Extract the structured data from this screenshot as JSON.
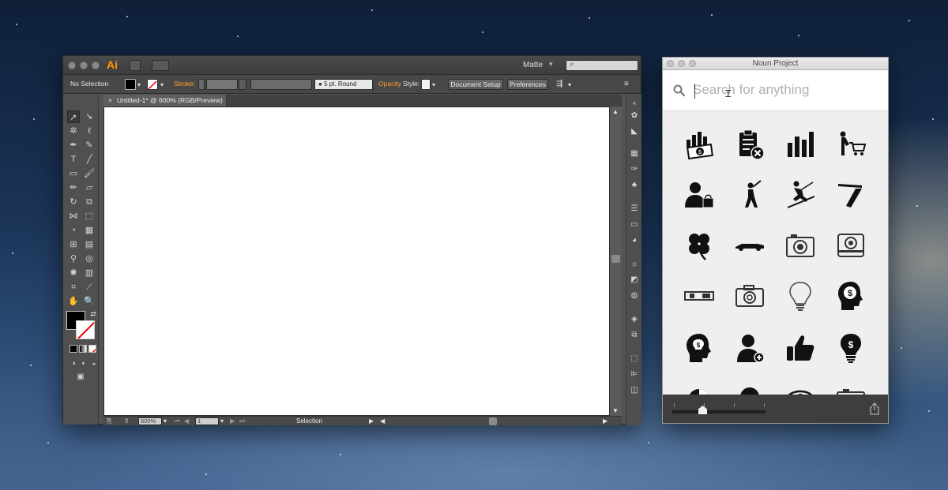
{
  "illustrator": {
    "logo": "Ai",
    "workspace": "Matte",
    "control_bar": {
      "selection": "No Selection",
      "stroke_label": "Stroke:",
      "brush": "5 pt. Round",
      "opacity_label": "Opacity",
      "style_label": "Style:",
      "document_setup": "Document Setup",
      "preferences": "Preferences"
    },
    "document_tab": {
      "close": "×",
      "title": "Untitled-1* @ 600% (RGB/Preview)"
    },
    "status_bar": {
      "zoom": "600%",
      "artboard": "1",
      "tool": "Selection"
    }
  },
  "noun_project": {
    "title": "Noun Project",
    "search_placeholder": "Search for anything",
    "icons": [
      "money-stats-icon",
      "clipboard-delete-icon",
      "bar-chart-icon",
      "shopping-cart-person-icon",
      "person-shopping-bag-icon",
      "baseball-batter-icon",
      "skier-icon",
      "straight-razor-icon",
      "four-leaf-clover-icon",
      "race-car-icon",
      "camera-icon",
      "polaroid-camera-icon",
      "panoramic-camera-icon",
      "camera-outline-icon",
      "lightbulb-icon",
      "head-money-icon",
      "head-lightbulb-money-icon",
      "add-person-icon",
      "thumbs-up-icon",
      "lightbulb-money-icon"
    ]
  },
  "colors": {
    "ai_orange": "#ff9a00",
    "ai_panel": "#535353",
    "np_footer": "#3e3e3e"
  }
}
